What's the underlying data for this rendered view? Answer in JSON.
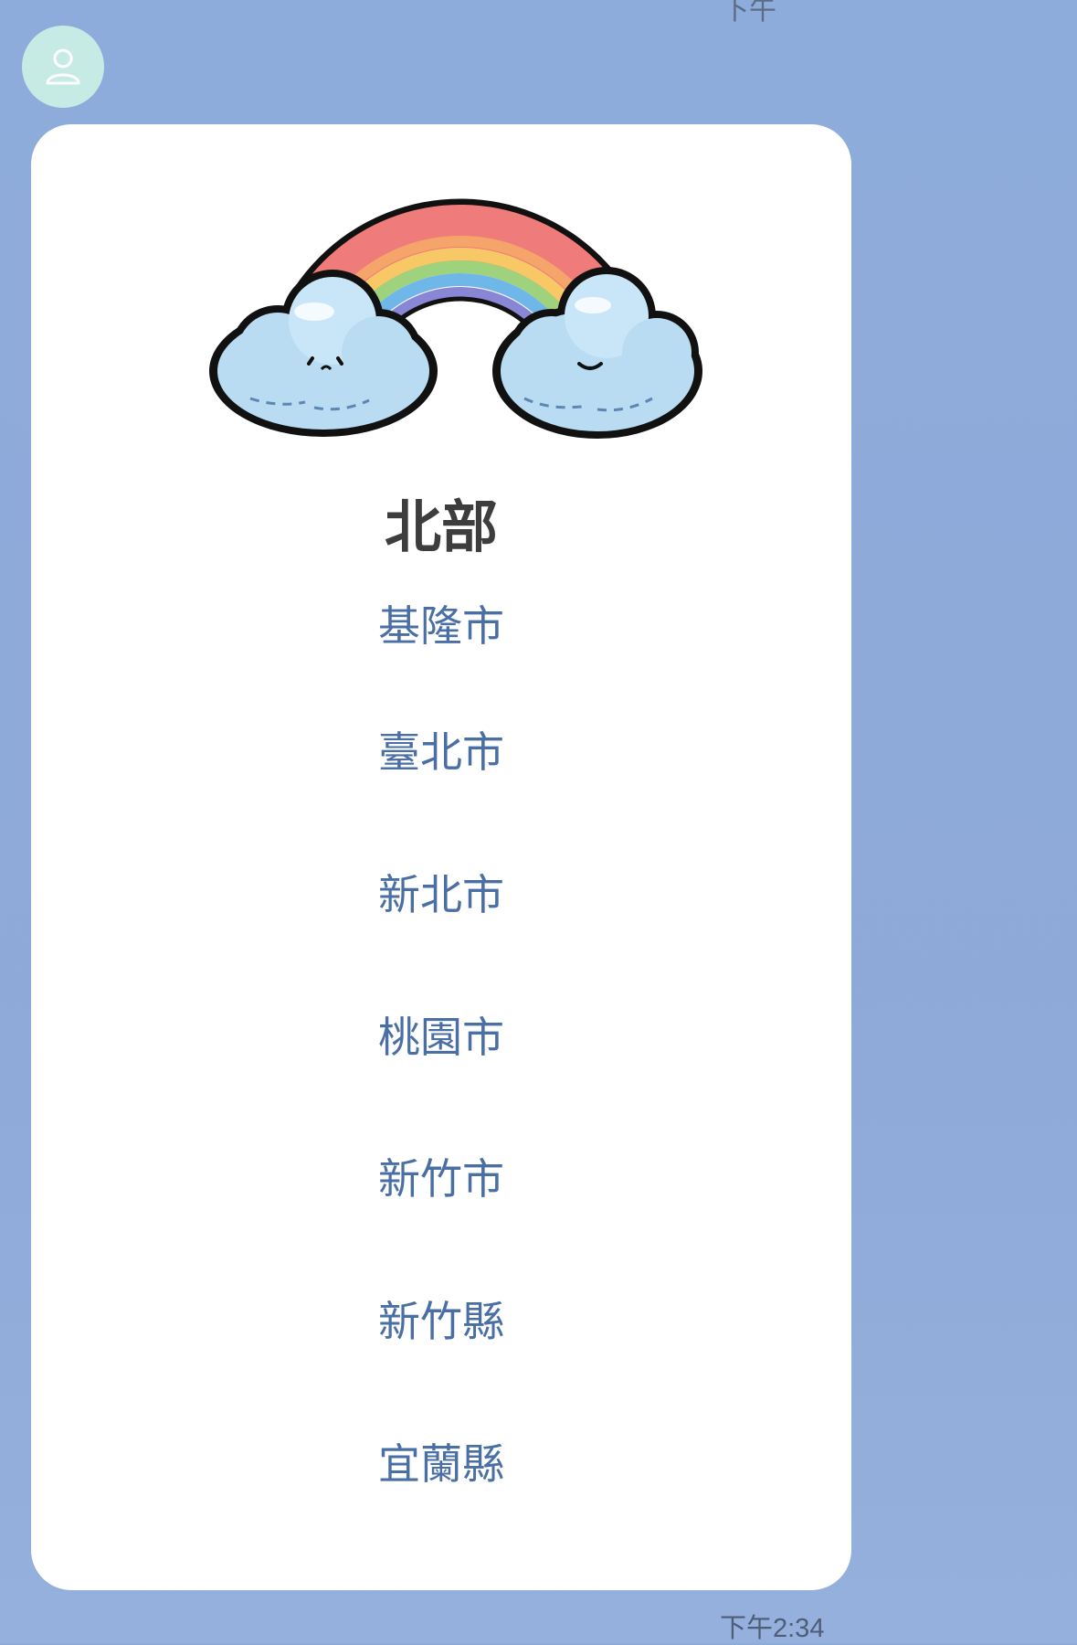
{
  "chat": {
    "top_time": "下午",
    "timestamp": "下午2:34"
  },
  "card": {
    "title": "北部",
    "items": [
      {
        "label": "基隆市"
      },
      {
        "label": "臺北市"
      },
      {
        "label": "新北市"
      },
      {
        "label": "桃園市"
      },
      {
        "label": "新竹市"
      },
      {
        "label": "新竹縣"
      },
      {
        "label": "宜蘭縣"
      }
    ],
    "image": "rainbow-with-clouds"
  },
  "colors": {
    "background": "#8eacdb",
    "avatar": "#c5ebe4",
    "link": "#4a6fa5",
    "title": "#3d3d3d"
  }
}
